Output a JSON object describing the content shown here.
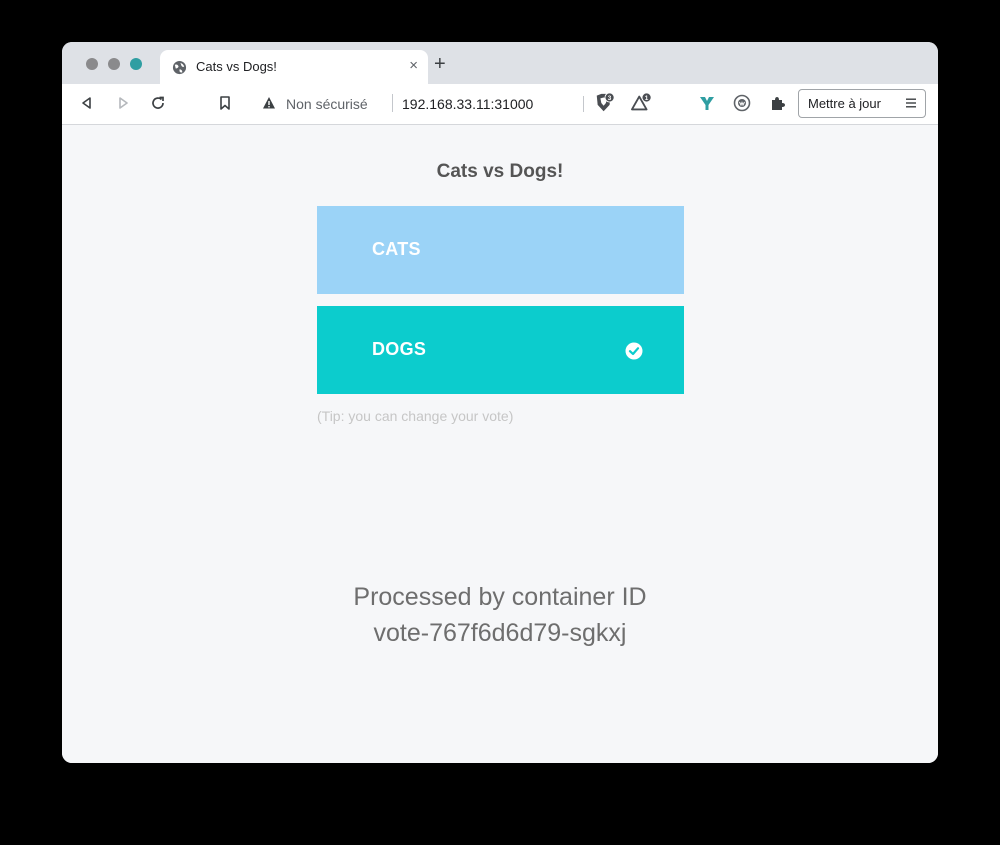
{
  "browser": {
    "tab": {
      "title": "Cats vs Dogs!",
      "close_glyph": "×",
      "favicon": "globe-icon"
    },
    "new_tab_glyph": "+",
    "toolbar": {
      "icons": [
        "back-icon",
        "forward-icon",
        "reload-icon",
        "bookmark-icon",
        "brave-shield-icon",
        "brave-rewards-icon",
        "vpn-icon",
        "wallet-icon",
        "extensions-icon",
        "menu-icon"
      ],
      "security_status": "Non sécurisé",
      "url": "192.168.33.11:31000",
      "shield_badge": "3",
      "rewards_badge": "1",
      "update_label": "Mettre à jour"
    }
  },
  "page": {
    "title": "Cats vs Dogs!",
    "options": [
      {
        "label": "CATS",
        "color": "#9bd3f7",
        "selected": false
      },
      {
        "label": "DOGS",
        "color": "#0ccccd",
        "selected": true
      }
    ],
    "tip": "(Tip: you can change your vote)",
    "footer_line1": "Processed by container ID",
    "footer_line2": "vote-767f6d6d79-sgkxj"
  }
}
